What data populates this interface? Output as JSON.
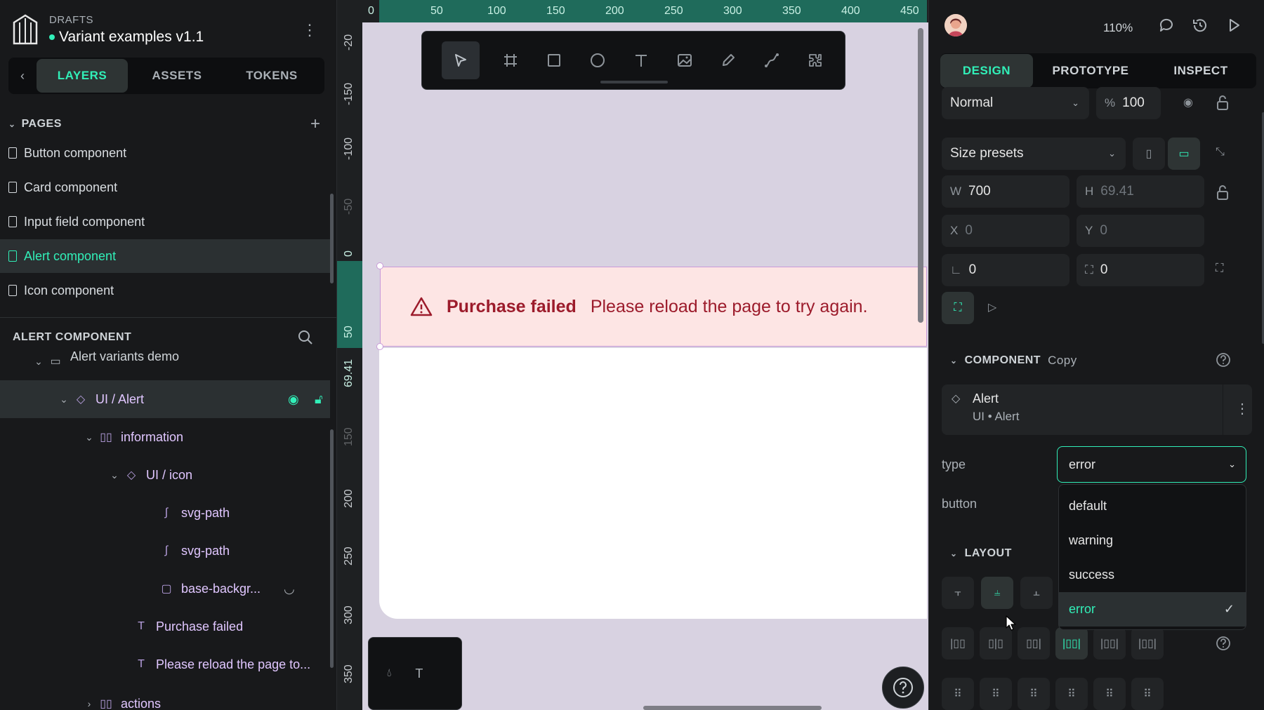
{
  "project": {
    "drafts_label": "DRAFTS",
    "title": "Variant examples v1.1"
  },
  "left_tabs": [
    "LAYERS",
    "ASSETS",
    "TOKENS"
  ],
  "pages": {
    "header": "PAGES",
    "items": [
      "Button component",
      "Card component",
      "Input field component",
      "Alert component",
      "Icon component"
    ]
  },
  "layers": {
    "header": "ALERT COMPONENT",
    "items": [
      {
        "label": "Alert variants demo"
      },
      {
        "label": "UI / Alert"
      },
      {
        "label": "information"
      },
      {
        "label": "UI / icon"
      },
      {
        "label": "svg-path"
      },
      {
        "label": "svg-path"
      },
      {
        "label": "base-backgr..."
      },
      {
        "label": "Purchase failed"
      },
      {
        "label": "Please reload the page to..."
      },
      {
        "label": "actions"
      }
    ]
  },
  "canvas": {
    "ruler_top": [
      "0",
      "50",
      "100",
      "150",
      "200",
      "250",
      "300",
      "350",
      "400",
      "450"
    ],
    "ruler_left": [
      "-20",
      "-150",
      "-100",
      "-50",
      "0",
      "50",
      "69.41",
      "150",
      "200",
      "250",
      "300",
      "350"
    ],
    "alert": {
      "title": "Purchase failed",
      "message": "Please reload the page to try again."
    },
    "colors": {
      "alert_bg": "#fde5e4",
      "alert_text": "#9c1b2b",
      "accent": "#31efb8"
    }
  },
  "right": {
    "zoom": "110%",
    "tabs": [
      "DESIGN",
      "PROTOTYPE",
      "INSPECT"
    ],
    "blend": "Normal",
    "opacity_prefix": "%",
    "opacity": "100",
    "size_presets": "Size presets",
    "w_label": "W",
    "w": "700",
    "h_label": "H",
    "h": "69.41",
    "x_label": "X",
    "x": "0",
    "y_label": "Y",
    "y": "0",
    "rotation": "0",
    "radius": "0",
    "component": {
      "header": "COMPONENT",
      "copy_label": "Copy",
      "name": "Alert",
      "path": "UI • Alert"
    },
    "props": {
      "type_label": "type",
      "type_value": "error",
      "button_label": "button"
    },
    "dropdown_options": [
      "default",
      "warning",
      "success",
      "error"
    ],
    "layout_header": "LAYOUT"
  }
}
